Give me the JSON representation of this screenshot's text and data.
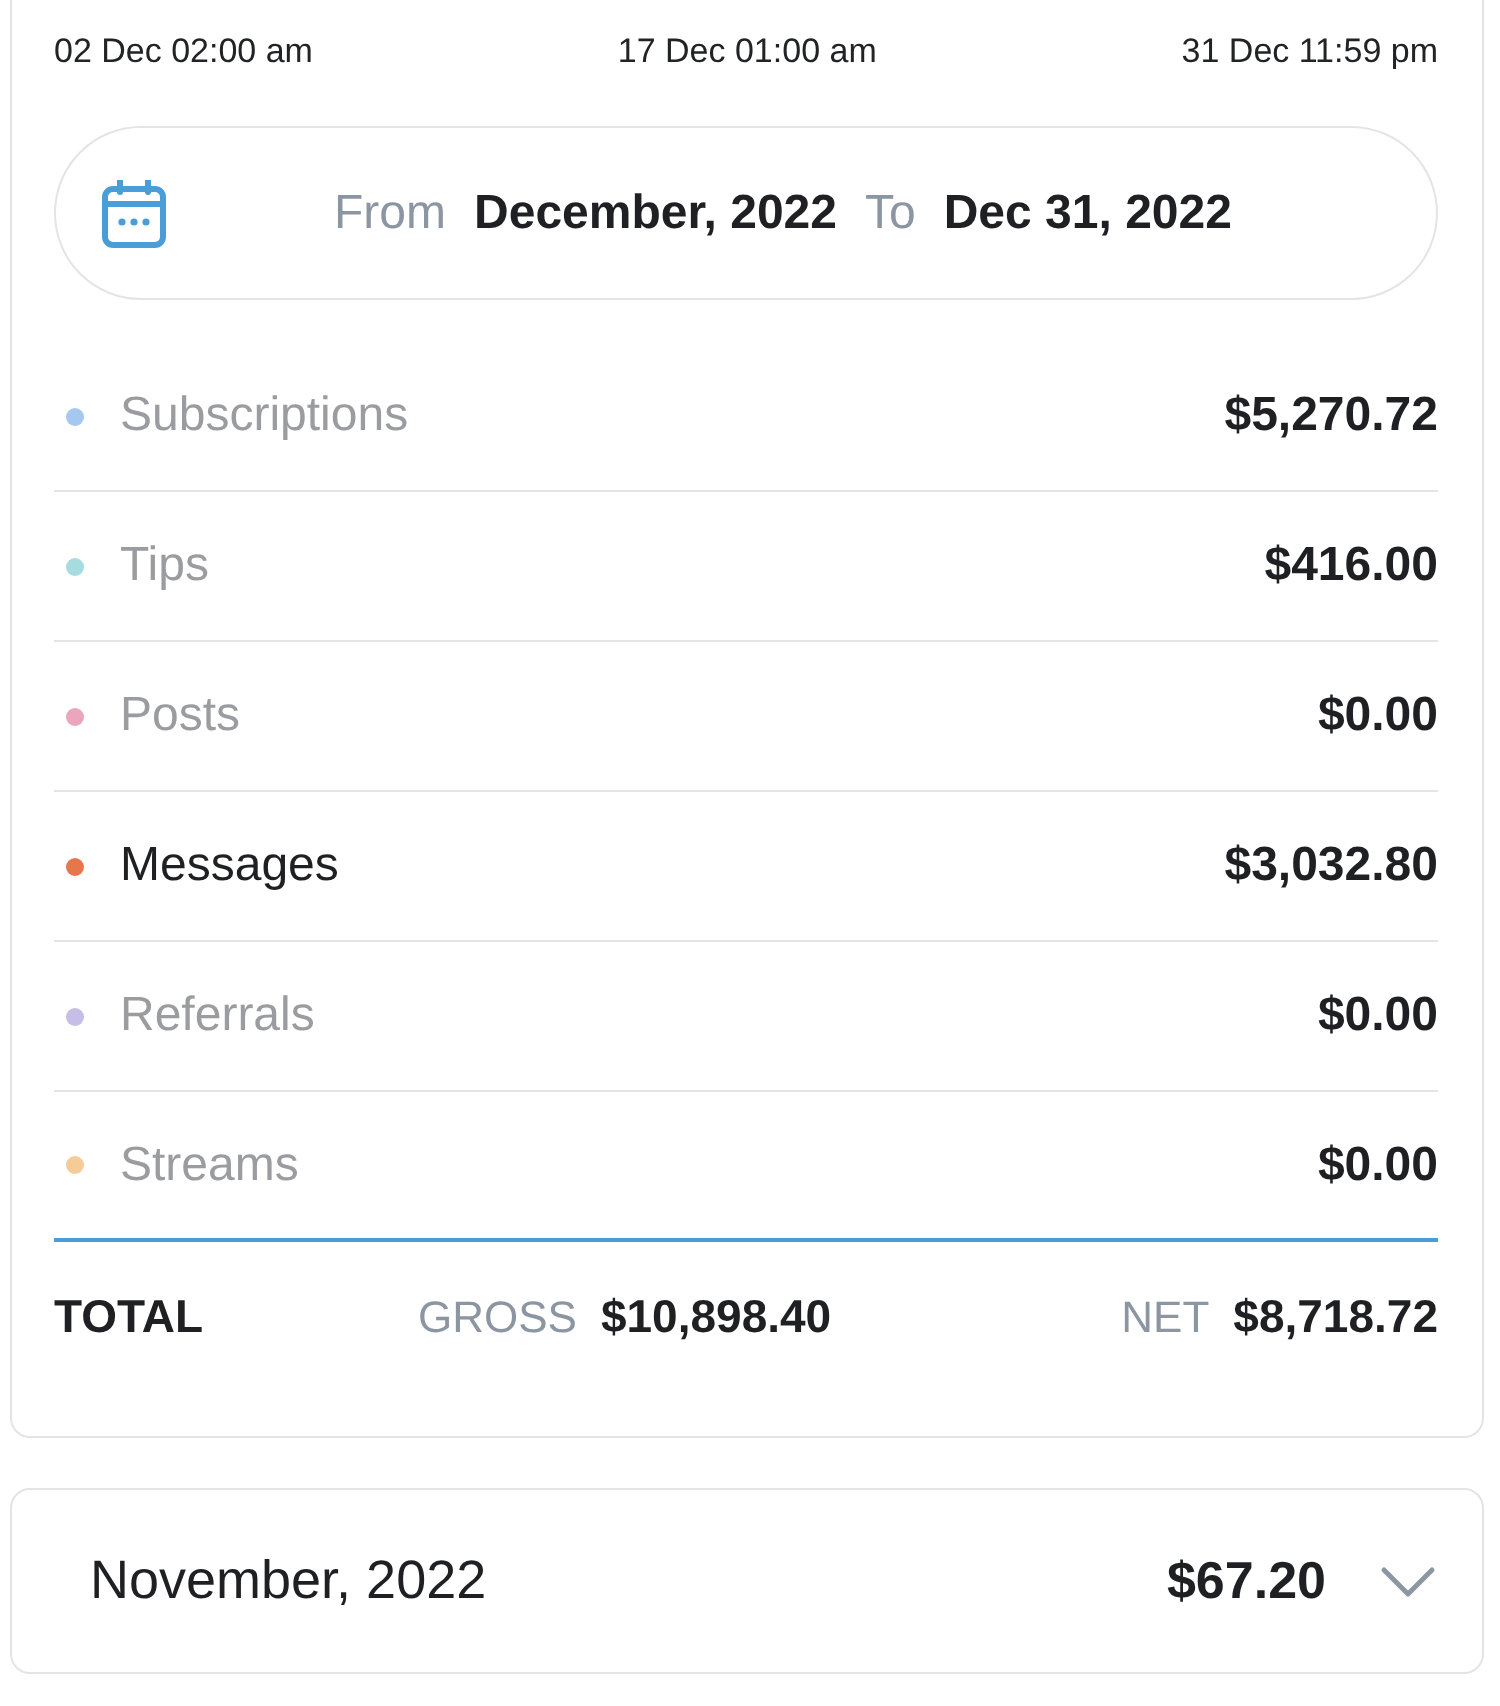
{
  "timeline_labels": [
    "02 Dec 02:00 am",
    "17 Dec 01:00 am",
    "31 Dec 11:59 pm"
  ],
  "date_range": {
    "from_label": "From",
    "from_value": "December, 2022",
    "to_label": "To",
    "to_value": "Dec 31, 2022"
  },
  "categories": [
    {
      "name": "Subscriptions",
      "amount": "$5,270.72",
      "color": "#a4c8ef",
      "selected": false
    },
    {
      "name": "Tips",
      "amount": "$416.00",
      "color": "#a6dbe0",
      "selected": false
    },
    {
      "name": "Posts",
      "amount": "$0.00",
      "color": "#eba5bd",
      "selected": false
    },
    {
      "name": "Messages",
      "amount": "$3,032.80",
      "color": "#e8764d",
      "selected": true
    },
    {
      "name": "Referrals",
      "amount": "$0.00",
      "color": "#c6bee6",
      "selected": false
    },
    {
      "name": "Streams",
      "amount": "$0.00",
      "color": "#f6cb98",
      "selected": false
    }
  ],
  "total": {
    "label": "TOTAL",
    "gross_label": "GROSS",
    "gross_value": "$10,898.40",
    "net_label": "NET",
    "net_value": "$8,718.72"
  },
  "months": [
    {
      "title": "November, 2022",
      "amount": "$67.20",
      "expanded": false
    }
  ]
}
